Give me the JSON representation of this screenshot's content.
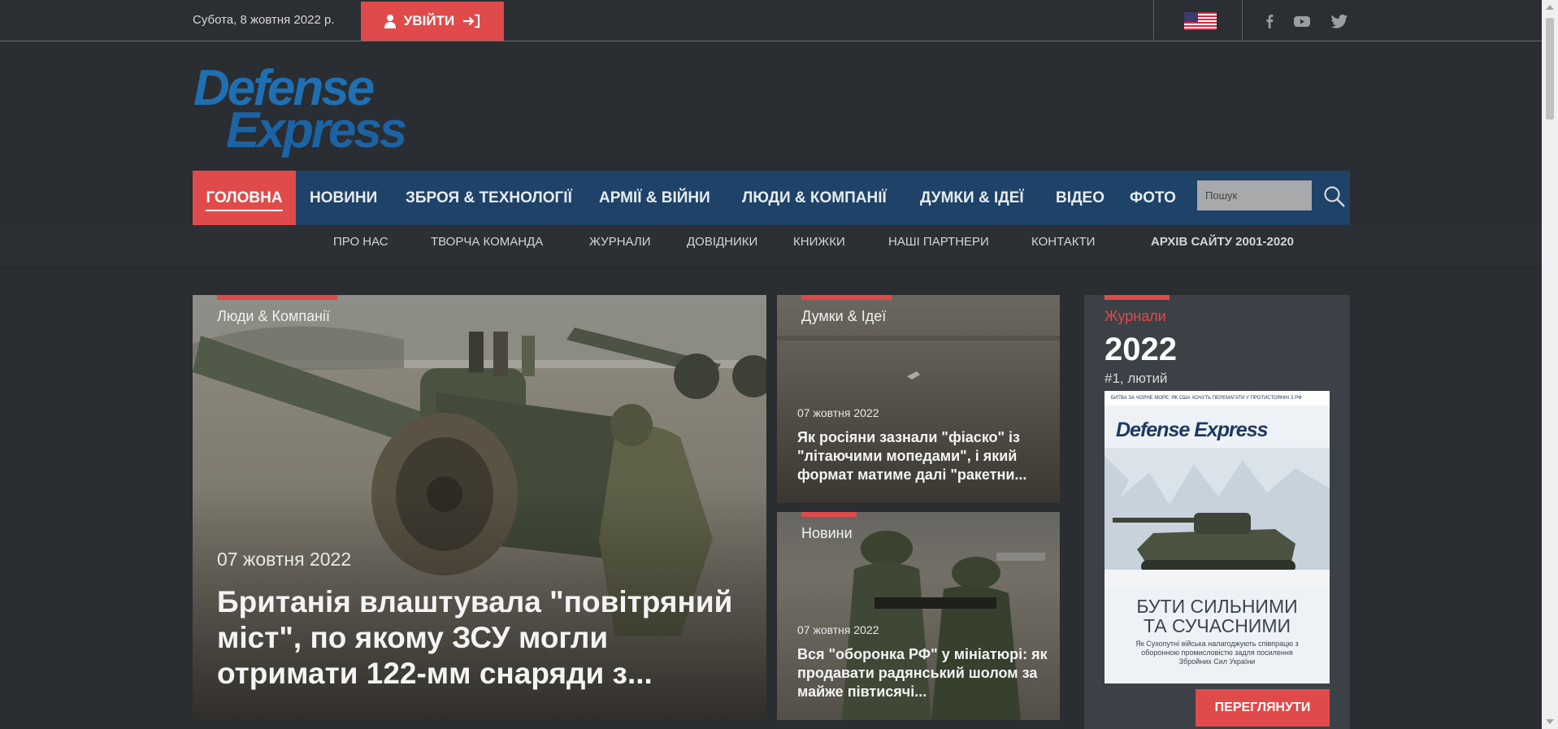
{
  "topbar": {
    "date": "Субота, 8 жовтня 2022 р.",
    "login_label": "УВІЙТИ",
    "language_icon": "us-flag-icon",
    "social": [
      "facebook-icon",
      "youtube-icon",
      "twitter-icon"
    ]
  },
  "logo": {
    "line1": "Defense",
    "line2": "Express"
  },
  "nav": {
    "items": [
      {
        "label": "ГОЛОВНА",
        "active": true
      },
      {
        "label": "НОВИНИ"
      },
      {
        "label": "ЗБРОЯ & ТЕХНОЛОГІЇ"
      },
      {
        "label": "АРМІЇ & ВІЙНИ"
      },
      {
        "label": "ЛЮДИ & КОМПАНІЇ"
      },
      {
        "label": "ДУМКИ & ІДЕЇ"
      },
      {
        "label": "ВІДЕО"
      },
      {
        "label": "ФОТО"
      }
    ],
    "search_placeholder": "Пошук"
  },
  "subnav": {
    "items": [
      {
        "label": "ПРО НАС"
      },
      {
        "label": "ТВОРЧА КОМАНДА"
      },
      {
        "label": "ЖУРНАЛИ"
      },
      {
        "label": "ДОВІДНИКИ"
      },
      {
        "label": "КНИЖКИ"
      },
      {
        "label": "НАШІ ПАРТНЕРИ"
      },
      {
        "label": "КОНТАКТИ"
      },
      {
        "label": "АРХІВ САЙТУ 2001-2020"
      }
    ]
  },
  "articles": [
    {
      "tag": "Люди & Компанії",
      "date": "07 жовтня 2022",
      "title": "Британія влаштувала \"повітряний міст\", по якому ЗСУ могли отримати 122-мм снаряди з..."
    },
    {
      "tag": "Думки & Ідеї",
      "date": "07 жовтня 2022",
      "title": "Як росіяни зазнали \"фіаско\" із \"літаючими мопедами\", і який формат матиме далі \"ракетни..."
    },
    {
      "tag": "Новини",
      "date": "07 жовтня 2022",
      "title": "Вся \"оборонка РФ\" у мініатюрі: як продавати радянський шолом за майже півтисячі..."
    }
  ],
  "journal": {
    "label": "Журнали",
    "year": "2022",
    "issue": "#1, лютий",
    "cover_top": "БИТВА ЗА ЧОРНЕ МОРЕ: ЯК США ХОЧУТЬ ПЕРЕМАГАТИ У ПРОТИСТОЯННІ З РФ",
    "cover_brand": "Defense Express",
    "cover_headline_1": "БУТИ СИЛЬНИМИ",
    "cover_headline_2": "ТА СУЧАСНИМИ",
    "cover_sub": "Як Сухопутні війська налагоджують співпрацю з оборонною промисловістю задля посилення Збройних Сил України",
    "button_label": "ПЕРЕГЛЯНУТИ"
  },
  "colors": {
    "accent": "#e04a4a",
    "nav_bg": "#1e4268",
    "page_bg": "#2a2d31",
    "logo_blue": "#1f6fb3"
  }
}
